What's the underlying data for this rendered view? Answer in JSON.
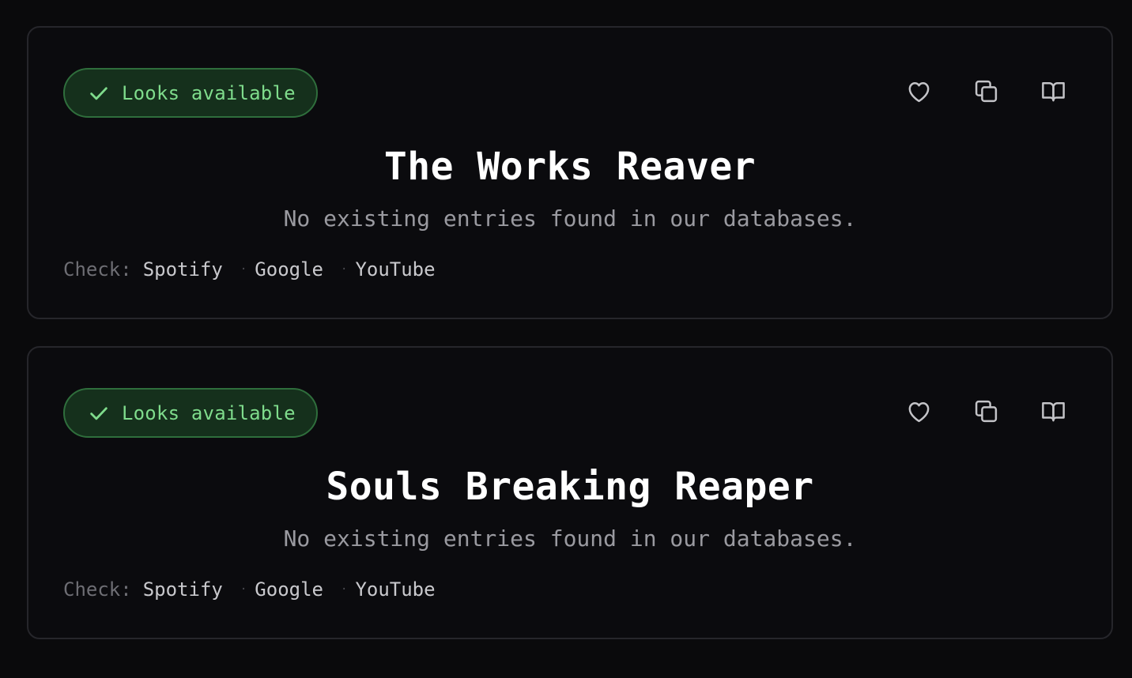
{
  "results": [
    {
      "badge_label": "Looks available",
      "name": "The Works Reaver",
      "message": "No existing entries found in our databases.",
      "check_label": "Check:",
      "check_links": [
        "Spotify",
        "Google",
        "YouTube"
      ],
      "separator": "·"
    },
    {
      "badge_label": "Looks available",
      "name": "Souls Breaking Reaper",
      "message": "No existing entries found in our databases.",
      "check_label": "Check:",
      "check_links": [
        "Spotify",
        "Google",
        "YouTube"
      ],
      "separator": "·"
    }
  ],
  "icons": {
    "badge": "check-icon",
    "actions": [
      "heart-icon",
      "copy-icon",
      "book-icon"
    ]
  },
  "colors": {
    "background": "#0a0a0c",
    "card_border": "#26262b",
    "badge_bg": "#15301c",
    "badge_border": "#2f6e3c",
    "badge_text": "#7fdc8c",
    "title": "#ffffff",
    "subtitle": "#9a9aa0",
    "icon": "#c4c4c8"
  }
}
